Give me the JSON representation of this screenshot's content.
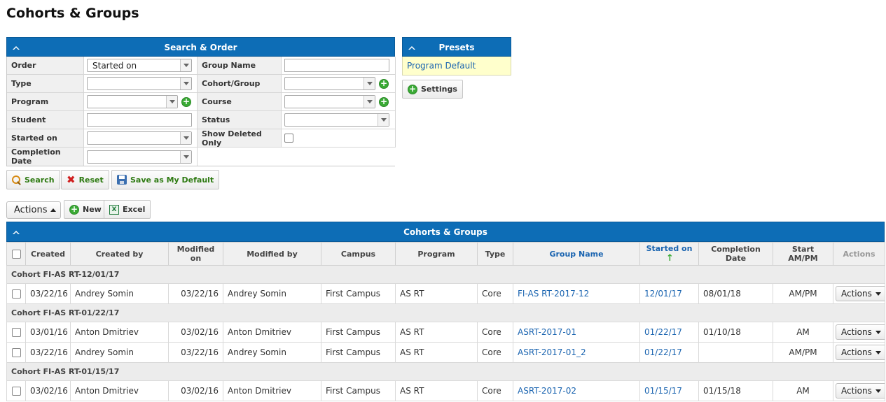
{
  "page": {
    "title": "Cohorts & Groups"
  },
  "search": {
    "header": "Search & Order",
    "labels": {
      "order": "Order",
      "group_name": "Group Name",
      "type": "Type",
      "cohort_group": "Cohort/Group",
      "program": "Program",
      "course": "Course",
      "student": "Student",
      "status": "Status",
      "started_on": "Started on",
      "show_deleted_only": "Show Deleted Only",
      "completion_date": "Completion Date"
    },
    "values": {
      "order": "Started on"
    },
    "buttons": {
      "search": "Search",
      "reset": "Reset",
      "save_default": "Save as My Default"
    }
  },
  "presets": {
    "header": "Presets",
    "items": [
      "Program Default"
    ],
    "settings_label": "Settings"
  },
  "toolbar": {
    "actions": "Actions",
    "new": "New",
    "excel": "Excel"
  },
  "grid": {
    "header": "Cohorts & Groups",
    "columns": [
      "Created",
      "Created by",
      "Modified on",
      "Modified by",
      "Campus",
      "Program",
      "Type",
      "Group Name",
      "Started on",
      "Completion Date",
      "Start AM/PM",
      "Actions"
    ],
    "row_action_label": "Actions",
    "groups": [
      {
        "label": "Cohort FI-AS RT-12/01/17",
        "rows": [
          [
            "03/22/16",
            "Andrey Somin",
            "03/22/16",
            "Andrey Somin",
            "First Campus",
            "AS RT",
            "Core",
            "FI-AS RT-2017-12",
            "12/01/17",
            "08/01/18",
            "AM/PM"
          ]
        ]
      },
      {
        "label": "Cohort FI-AS RT-01/22/17",
        "rows": [
          [
            "03/01/16",
            "Anton Dmitriev",
            "03/02/16",
            "Anton Dmitriev",
            "First Campus",
            "AS RT",
            "Core",
            "ASRT-2017-01",
            "01/22/17",
            "01/10/18",
            "AM"
          ],
          [
            "03/22/16",
            "Andrey Somin",
            "03/22/16",
            "Andrey Somin",
            "First Campus",
            "AS RT",
            "Core",
            "ASRT-2017-01_2",
            "01/22/17",
            "",
            "AM/PM"
          ]
        ]
      },
      {
        "label": "Cohort FI-AS RT-01/15/17",
        "rows": [
          [
            "03/02/16",
            "Anton Dmitriev",
            "03/02/16",
            "Anton Dmitriev",
            "First Campus",
            "AS RT",
            "Core",
            "ASRT-2017-02",
            "01/15/17",
            "01/15/18",
            "AM"
          ]
        ]
      }
    ]
  }
}
